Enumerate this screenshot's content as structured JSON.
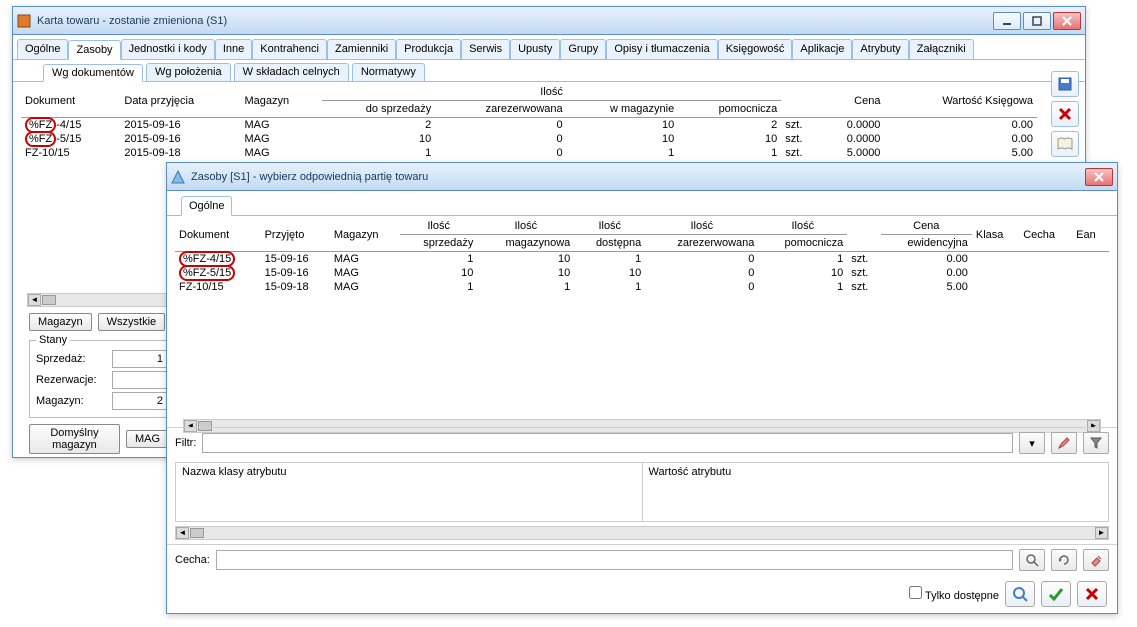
{
  "window1": {
    "title": "Karta towaru - zostanie zmieniona (S1)",
    "tabs": [
      "Ogólne",
      "Zasoby",
      "Jednostki i kody",
      "Inne",
      "Kontrahenci",
      "Zamienniki",
      "Produkcja",
      "Serwis",
      "Upusty",
      "Grupy",
      "Opisy i tłumaczenia",
      "Księgowość",
      "Aplikacje",
      "Atrybuty",
      "Załączniki"
    ],
    "active_tab": "Zasoby",
    "subtabs": [
      "Wg dokumentów",
      "Wg położenia",
      "W składach celnych",
      "Normatywy"
    ],
    "active_subtab": "Wg dokumentów",
    "grid": {
      "group_label": "Ilość",
      "cols": [
        "Dokument",
        "Data przyjęcia",
        "Magazyn",
        "do sprzedaży",
        "zarezerwowana",
        "w magazynie",
        "pomocnicza",
        "",
        "Cena",
        "Wartość Księgowa"
      ],
      "rows": [
        {
          "doc": "%FZ-4/15",
          "circled": true,
          "date": "2015-09-16",
          "mag": "MAG",
          "sprz": "2",
          "zar": "0",
          "wmag": "10",
          "pom": "2",
          "unit": "szt.",
          "cena": "0.0000",
          "wart": "0.00"
        },
        {
          "doc": "%FZ-5/15",
          "circled": true,
          "date": "2015-09-16",
          "mag": "MAG",
          "sprz": "10",
          "zar": "0",
          "wmag": "10",
          "pom": "10",
          "unit": "szt.",
          "cena": "0.0000",
          "wart": "0.00"
        },
        {
          "doc": "FZ-10/15",
          "circled": false,
          "date": "2015-09-18",
          "mag": "MAG",
          "sprz": "1",
          "zar": "0",
          "wmag": "1",
          "pom": "1",
          "unit": "szt.",
          "cena": "5.0000",
          "wart": "5.00"
        }
      ]
    },
    "buttons": {
      "magazyn": "Magazyn",
      "wszystkie": "Wszystkie",
      "domyslny": "Domyślny magazyn",
      "mag": "MAG"
    },
    "stany": {
      "legend": "Stany",
      "sprz_label": "Sprzedaż:",
      "sprz_val": "1",
      "rez_label": "Rezerwacje:",
      "rez_val": "",
      "mag_label": "Magazyn:",
      "mag_val": "2"
    }
  },
  "window2": {
    "title": "Zasoby [S1] - wybierz odpowiednią partię towaru",
    "tab": "Ogólne",
    "grid": {
      "cols": [
        "Dokument",
        "Przyjęto",
        "Magazyn",
        "Ilość sprzedaży",
        "Ilość magazynowa",
        "Ilość dostępna",
        "Ilość zarezerwowana",
        "Ilość pomocnicza",
        "",
        "Cena ewidencyjna",
        "Klasa",
        "Cecha",
        "Ean"
      ],
      "rows": [
        {
          "doc": "%FZ-4/15",
          "circled": true,
          "date": "15-09-16",
          "mag": "MAG",
          "sprz": "1",
          "magaz": "10",
          "dost": "1",
          "zar": "0",
          "pom": "1",
          "unit": "szt.",
          "cena": "0.00"
        },
        {
          "doc": "%FZ-5/15",
          "circled": true,
          "date": "15-09-16",
          "mag": "MAG",
          "sprz": "10",
          "magaz": "10",
          "dost": "10",
          "zar": "0",
          "pom": "10",
          "unit": "szt.",
          "cena": "0.00"
        },
        {
          "doc": "FZ-10/15",
          "circled": false,
          "date": "15-09-18",
          "mag": "MAG",
          "sprz": "1",
          "magaz": "1",
          "dost": "1",
          "zar": "0",
          "pom": "1",
          "unit": "szt.",
          "cena": "5.00"
        }
      ]
    },
    "filter_label": "Filtr:",
    "attr_col1": "Nazwa klasy atrybutu",
    "attr_col2": "Wartość atrybutu",
    "cecha_label": "Cecha:",
    "tylko_dostepne": "Tylko dostępne"
  }
}
